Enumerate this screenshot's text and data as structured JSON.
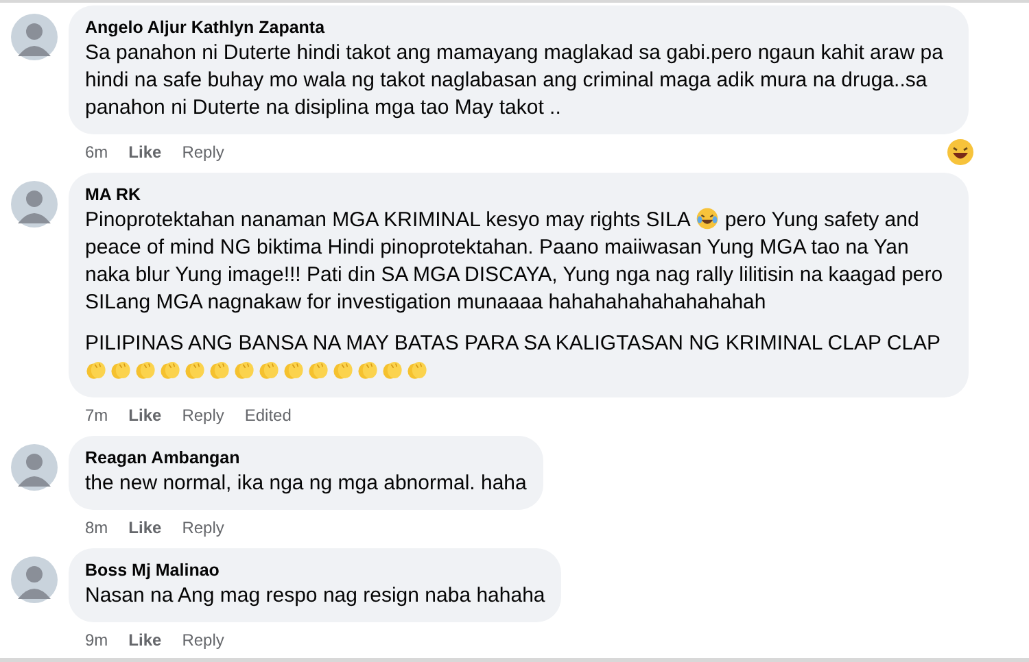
{
  "comments": [
    {
      "author": "Angelo Aljur Kathlyn Zapanta",
      "paragraphs": [
        [
          {
            "kind": "text",
            "text": "Sa panahon ni Duterte hindi takot ang mamayang maglakad sa gabi.pero ngaun kahit araw pa hindi na safe buhay mo wala ng takot naglabasan ang criminal maga adik mura na druga..sa panahon ni Duterte na disiplina mga tao May takot .."
          }
        ]
      ],
      "time": "6m",
      "actions": [
        "Like",
        "Reply"
      ],
      "reaction": {
        "kind": "laugh"
      }
    },
    {
      "author": "MA RK",
      "paragraphs": [
        [
          {
            "kind": "text",
            "text": "Pinoprotektahan nanaman MGA KRIMINAL kesyo may rights SILA"
          },
          {
            "kind": "tears"
          },
          {
            "kind": "text",
            "text": "pero Yung safety and peace of mind NG biktima Hindi pinoprotektahan. Paano maiiwasan Yung MGA tao na Yan naka blur Yung image!!! Pati din SA MGA DISCAYA, Yung nga nag rally lilitisin na kaagad pero SILang MGA nagnakaw for investigation munaaaa hahahahahahahahahah"
          }
        ],
        [
          {
            "kind": "text",
            "text": "PILIPINAS ANG BANSA NA MAY BATAS PARA SA KALIGTASAN NG KRIMINAL CLAP CLAP"
          }
        ],
        [
          {
            "kind": "clap"
          },
          {
            "kind": "clap"
          },
          {
            "kind": "clap"
          },
          {
            "kind": "clap"
          },
          {
            "kind": "clap"
          },
          {
            "kind": "clap"
          },
          {
            "kind": "clap"
          },
          {
            "kind": "clap"
          },
          {
            "kind": "clap"
          },
          {
            "kind": "clap"
          },
          {
            "kind": "clap"
          },
          {
            "kind": "clap"
          },
          {
            "kind": "clap"
          },
          {
            "kind": "clap"
          }
        ]
      ],
      "time": "7m",
      "actions": [
        "Like",
        "Reply"
      ],
      "edited": "Edited"
    },
    {
      "author": "Reagan Ambangan",
      "paragraphs": [
        [
          {
            "kind": "text",
            "text": "the new normal, ika nga ng mga abnormal. haha"
          }
        ]
      ],
      "time": "8m",
      "actions": [
        "Like",
        "Reply"
      ]
    },
    {
      "author": "Boss Mj Malinao",
      "paragraphs": [
        [
          {
            "kind": "text",
            "text": "Nasan na Ang mag respo nag resign naba hahaha"
          }
        ]
      ],
      "time": "9m",
      "actions": [
        "Like",
        "Reply"
      ]
    }
  ]
}
